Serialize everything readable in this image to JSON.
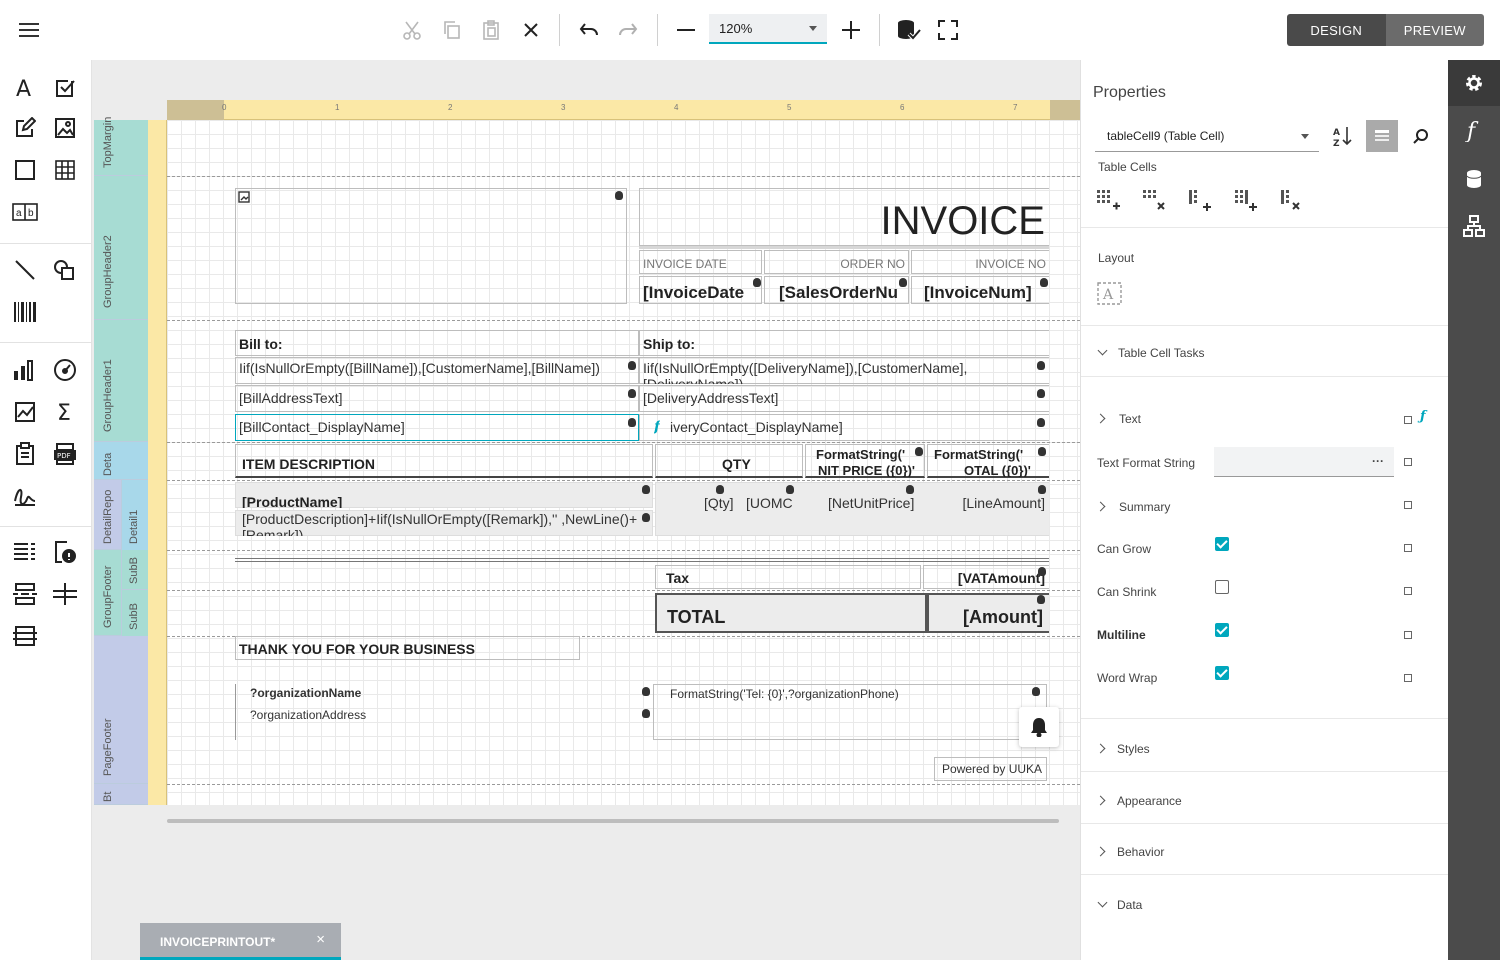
{
  "toolbar": {
    "zoom_value": "120%",
    "mode_design": "DESIGN",
    "mode_preview": "PREVIEW"
  },
  "ruler": {
    "ticks": [
      "0",
      "1",
      "2",
      "3",
      "4",
      "5",
      "6",
      "7"
    ]
  },
  "bands": [
    "TopMargin",
    "GroupHeader2",
    "GroupHeader1",
    "Deta",
    "DetailRepo",
    "Detail1",
    "GroupFooter",
    "SubB",
    "SubB",
    "PageFooter",
    "Bt"
  ],
  "report": {
    "invoice_title": "INVOICE",
    "col_invoice_date": "INVOICE DATE",
    "col_order_no": "ORDER NO",
    "col_invoice_no": "INVOICE NO",
    "val_invoice_date": "[InvoiceDate",
    "val_order_no": "[SalesOrderNu",
    "val_invoice_no": "[InvoiceNum]",
    "bill_to": "Bill to:",
    "ship_to": "Ship to:",
    "bill_name": "Iif(IsNullOrEmpty([BillName]),[CustomerName],[BillName])",
    "ship_name": "Iif(IsNullOrEmpty([DeliveryName]),[CustomerName],",
    "ship_name2": "[DeliveryName])",
    "bill_address": "[BillAddressText]",
    "ship_address": "[DeliveryAddressText]",
    "bill_contact": "[BillContact_DisplayName]",
    "ship_contact": "iveryContact_DisplayName]",
    "item_description": "ITEM DESCRIPTION",
    "qty": "QTY",
    "fmt_unit_price": "FormatString('",
    "fmt_unit_price2": "NIT PRICE ({0})'",
    "fmt_total": "FormatString('",
    "fmt_total2": "OTAL ({0})'",
    "product_name": "[ProductName]",
    "product_desc": "[ProductDescription]+Iif(IsNullOrEmpty([Remark]),'' ,NewLine()+",
    "product_desc2": "[Remark])",
    "qty_val": "[Qty]",
    "uom_val": "[UOMC",
    "net_unit_price": "[NetUnitPrice]",
    "line_amount": "[LineAmount]",
    "tax_label": "Tax",
    "vat_amount": "[VATAmount]",
    "total_label": "TOTAL",
    "amount": "[Amount]",
    "thank_you": "THANK YOU FOR YOUR BUSINESS",
    "org_name": "?organizationName",
    "org_address": "?organizationAddress",
    "org_phone": "FormatString('Tel: {0}',?organizationPhone)",
    "powered_by": "Powered by UUKA"
  },
  "file_tab": {
    "label": "INVOICEPRINTOUT*",
    "close": "×"
  },
  "properties": {
    "title": "Properties",
    "selected_object": "tableCell9 (Table Cell)",
    "table_cells_label": "Table Cells",
    "layout_label": "Layout",
    "table_cell_tasks": "Table Cell Tasks",
    "text": "Text",
    "text_format_string": "Text Format String",
    "text_format_value": "···",
    "summary": "Summary",
    "can_grow": "Can Grow",
    "can_shrink": "Can Shrink",
    "multiline": "Multiline",
    "word_wrap": "Word Wrap",
    "styles": "Styles",
    "appearance": "Appearance",
    "behavior": "Behavior",
    "data": "Data",
    "checks": {
      "can_grow": true,
      "can_shrink": false,
      "multiline": true,
      "word_wrap": true
    }
  },
  "colors": {
    "accent": "#00a7bd",
    "side_panel": "#4b4b4b",
    "ruler": "#fbe8a6"
  }
}
